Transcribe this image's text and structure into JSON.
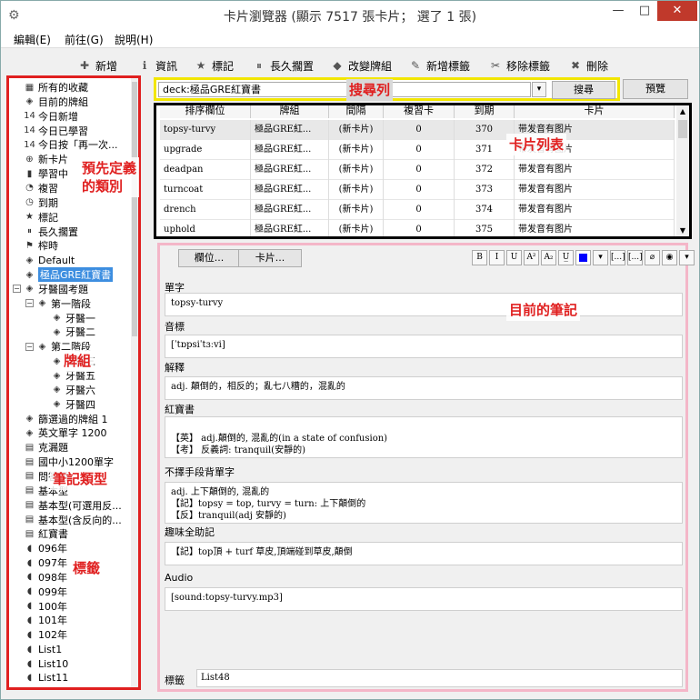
{
  "window": {
    "title": "卡片瀏覽器 (顯示 7517 張卡片； 選了 1 張)",
    "minimize": "—",
    "maximize": "□",
    "close": "✕"
  },
  "menu": [
    "編輯(E)",
    "前往(G)",
    "說明(H)"
  ],
  "toolbar": [
    {
      "label": "新增",
      "icon": "plus-icon",
      "glyph": "✚"
    },
    {
      "label": "資訊",
      "icon": "info-icon",
      "glyph": "ℹ"
    },
    {
      "label": "標記",
      "icon": "star-icon",
      "glyph": "★"
    },
    {
      "label": "長久擱置",
      "icon": "pause-icon",
      "glyph": "⏸"
    },
    {
      "label": "改變牌組",
      "icon": "deck-icon",
      "glyph": "◆"
    },
    {
      "label": "新增標籤",
      "icon": "tag-add-icon",
      "glyph": "✎"
    },
    {
      "label": "移除標籤",
      "icon": "tag-remove-icon",
      "glyph": "✂"
    },
    {
      "label": "刪除",
      "icon": "delete-icon",
      "glyph": "✖"
    }
  ],
  "sidebar": {
    "items": [
      {
        "label": "所有的收藏",
        "icon": "collection-icon",
        "glyph": "▦",
        "level": 0
      },
      {
        "label": "目前的牌組",
        "icon": "deck-icon",
        "glyph": "◈",
        "level": 0
      },
      {
        "label": "今日新增",
        "icon": "calendar-icon",
        "glyph": "14",
        "level": 0
      },
      {
        "label": "今日已學習",
        "icon": "calendar-icon",
        "glyph": "14",
        "level": 0
      },
      {
        "label": "今日按「再一次...",
        "icon": "calendar-icon",
        "glyph": "14",
        "level": 0
      },
      {
        "label": "新卡片",
        "icon": "plus-circle-icon",
        "glyph": "⊕",
        "level": 0
      },
      {
        "label": "學習中",
        "icon": "book-icon",
        "glyph": "▮",
        "level": 0
      },
      {
        "label": "複習",
        "icon": "clock-icon",
        "glyph": "◔",
        "level": 0
      },
      {
        "label": "到期",
        "icon": "clock-icon",
        "glyph": "◷",
        "level": 0
      },
      {
        "label": "標記",
        "icon": "star-icon",
        "glyph": "★",
        "level": 0
      },
      {
        "label": "長久擱置",
        "icon": "pause-icon",
        "glyph": "⏸",
        "level": 0
      },
      {
        "label": "榨時",
        "icon": "flag-icon",
        "glyph": "⚑",
        "level": 0
      },
      {
        "label": "Default",
        "icon": "deck-icon",
        "glyph": "◈",
        "level": 0
      },
      {
        "label": "極品GRE紅寶書",
        "icon": "deck-icon",
        "glyph": "◈",
        "level": 0,
        "selected": true
      },
      {
        "label": "牙醫國考題",
        "icon": "deck-icon",
        "glyph": "◈",
        "level": 0,
        "expand": "−"
      },
      {
        "label": "第一階段",
        "icon": "deck-icon",
        "glyph": "◈",
        "level": 1,
        "expand": "−"
      },
      {
        "label": "牙醫一",
        "icon": "deck-icon",
        "glyph": "◈",
        "level": 2
      },
      {
        "label": "牙醫二",
        "icon": "deck-icon",
        "glyph": "◈",
        "level": 2
      },
      {
        "label": "第二階段",
        "icon": "deck-icon",
        "glyph": "◈",
        "level": 1,
        "expand": "−"
      },
      {
        "label": "牙醫三",
        "icon": "deck-icon",
        "glyph": "◈",
        "level": 2
      },
      {
        "label": "牙醫五",
        "icon": "deck-icon",
        "glyph": "◈",
        "level": 2
      },
      {
        "label": "牙醫六",
        "icon": "deck-icon",
        "glyph": "◈",
        "level": 2
      },
      {
        "label": "牙醫四",
        "icon": "deck-icon",
        "glyph": "◈",
        "level": 2
      },
      {
        "label": "篩選過的牌組 1",
        "icon": "deck-icon",
        "glyph": "◈",
        "level": 0
      },
      {
        "label": "英文單字 1200",
        "icon": "deck-icon",
        "glyph": "◈",
        "level": 0
      },
      {
        "label": "克漏題",
        "icon": "note-type-icon",
        "glyph": "▤",
        "level": 0
      },
      {
        "label": "國中小1200單字",
        "icon": "note-type-icon",
        "glyph": "▤",
        "level": 0
      },
      {
        "label": "問答題",
        "icon": "note-type-icon",
        "glyph": "▤",
        "level": 0
      },
      {
        "label": "基本型",
        "icon": "note-type-icon",
        "glyph": "▤",
        "level": 0
      },
      {
        "label": "基本型(可選用反...",
        "icon": "note-type-icon",
        "glyph": "▤",
        "level": 0
      },
      {
        "label": "基本型(含反向的...",
        "icon": "note-type-icon",
        "glyph": "▤",
        "level": 0
      },
      {
        "label": "紅寶書",
        "icon": "note-type-icon",
        "glyph": "▤",
        "level": 0
      },
      {
        "label": "096年",
        "icon": "tag-icon",
        "glyph": "◖",
        "level": 0
      },
      {
        "label": "097年",
        "icon": "tag-icon",
        "glyph": "◖",
        "level": 0
      },
      {
        "label": "098年",
        "icon": "tag-icon",
        "glyph": "◖",
        "level": 0
      },
      {
        "label": "099年",
        "icon": "tag-icon",
        "glyph": "◖",
        "level": 0
      },
      {
        "label": "100年",
        "icon": "tag-icon",
        "glyph": "◖",
        "level": 0
      },
      {
        "label": "101年",
        "icon": "tag-icon",
        "glyph": "◖",
        "level": 0
      },
      {
        "label": "102年",
        "icon": "tag-icon",
        "glyph": "◖",
        "level": 0
      },
      {
        "label": "List1",
        "icon": "tag-icon",
        "glyph": "◖",
        "level": 0
      },
      {
        "label": "List10",
        "icon": "tag-icon",
        "glyph": "◖",
        "level": 0
      },
      {
        "label": "List11",
        "icon": "tag-icon",
        "glyph": "◖",
        "level": 0
      }
    ]
  },
  "search": {
    "value": "deck:極品GRE紅寶書",
    "dropdown_glyph": "▾",
    "search_button": "搜尋",
    "preview_button": "預覽"
  },
  "cardlist": {
    "columns": [
      "排序欄位",
      "牌組",
      "間隔",
      "複習卡",
      "到期",
      "卡片"
    ],
    "rows": [
      [
        "topsy-turvy",
        "極品GRE紅...",
        "(新卡片)",
        "0",
        "370",
        "带发音有图片"
      ],
      [
        "upgrade",
        "極品GRE紅...",
        "(新卡片)",
        "0",
        "371",
        "带发音有图片"
      ],
      [
        "deadpan",
        "極品GRE紅...",
        "(新卡片)",
        "0",
        "372",
        "带发音有图片"
      ],
      [
        "turncoat",
        "極品GRE紅...",
        "(新卡片)",
        "0",
        "373",
        "带发音有图片"
      ],
      [
        "drench",
        "極品GRE紅...",
        "(新卡片)",
        "0",
        "374",
        "带发音有图片"
      ],
      [
        "uphold",
        "極品GRE紅...",
        "(新卡片)",
        "0",
        "375",
        "带发音有图片"
      ]
    ],
    "scroll_up": "▲",
    "scroll_down": "▼"
  },
  "editor": {
    "fields_button": "欄位...",
    "cards_button": "卡片...",
    "format": [
      "B",
      "I",
      "U",
      "A²",
      "A₂",
      "U̲",
      "",
      "▾",
      "[...]",
      "[...]",
      "⌀",
      "◉",
      "▾"
    ],
    "fields": [
      {
        "label": "單字",
        "value": "topsy-turvy"
      },
      {
        "label": "音標",
        "value": "[ˈtɒpsiˈtɜːvi]"
      },
      {
        "label": "解釋",
        "value": "adj. 顛倒的，相反的；亂七八糟的，混亂的"
      },
      {
        "label": "紅寶書",
        "value": "\n【英】 adj.顛倒的, 混亂的(in a state of confusion)\n【考】 反義詞: tranquil(安靜的)"
      },
      {
        "label": "不擇手段背單字",
        "value": "adj. 上下顛倒的, 混亂的\n【記】topsy = top, turvy = turn: 上下顛倒的\n【反】tranquil(adj 安靜的)"
      },
      {
        "label": "趣味全助記",
        "value": "【記】top頂 + turf 草皮,頂端碰到草皮,顛倒"
      },
      {
        "label": "Audio",
        "value": "[sound:topsy-turvy.mp3]"
      }
    ],
    "tags_label": "標籤",
    "tags_value": "List48"
  },
  "annotations": {
    "predefined": "預先定義\n的類別",
    "search_bar": "搜尋列",
    "card_list": "卡片列表",
    "current_note": "目前的筆記",
    "deck": "牌組",
    "note_type": "筆記類型",
    "tags": "標籤"
  }
}
